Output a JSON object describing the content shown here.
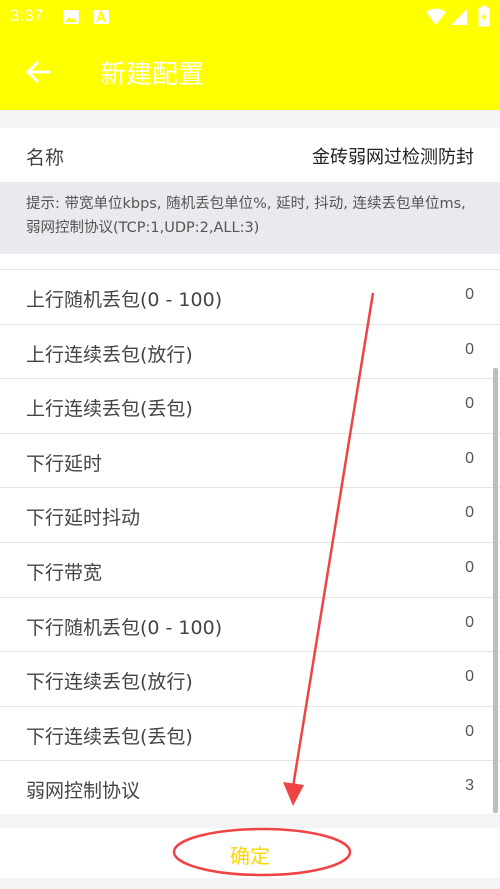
{
  "status_bar": {
    "time": "3:37"
  },
  "app_bar": {
    "title": "新建配置"
  },
  "name_field": {
    "label": "名称",
    "value": "金砖弱网过检测防封"
  },
  "hint": {
    "text": "提示: 带宽单位kbps, 随机丢包单位%, 延时, 抖动, 连续丢包单位ms, 弱网控制协议(TCP:1,UDP:2,ALL:3)"
  },
  "settings": [
    {
      "label": "上行随机丢包(0 - 100)",
      "value": "0"
    },
    {
      "label": "上行连续丢包(放行)",
      "value": "0"
    },
    {
      "label": "上行连续丢包(丢包)",
      "value": "0"
    },
    {
      "label": "下行延时",
      "value": "0"
    },
    {
      "label": "下行延时抖动",
      "value": "0"
    },
    {
      "label": "下行带宽",
      "value": "0"
    },
    {
      "label": "下行随机丢包(0 - 100)",
      "value": "0"
    },
    {
      "label": "下行连续丢包(放行)",
      "value": "0"
    },
    {
      "label": "下行连续丢包(丢包)",
      "value": "0"
    },
    {
      "label": "弱网控制协议",
      "value": "3"
    }
  ],
  "confirm_button": {
    "label": "确定"
  },
  "colors": {
    "accent": "#ffff00",
    "annotation": "#ef4444",
    "confirm_text": "#ffd600"
  }
}
